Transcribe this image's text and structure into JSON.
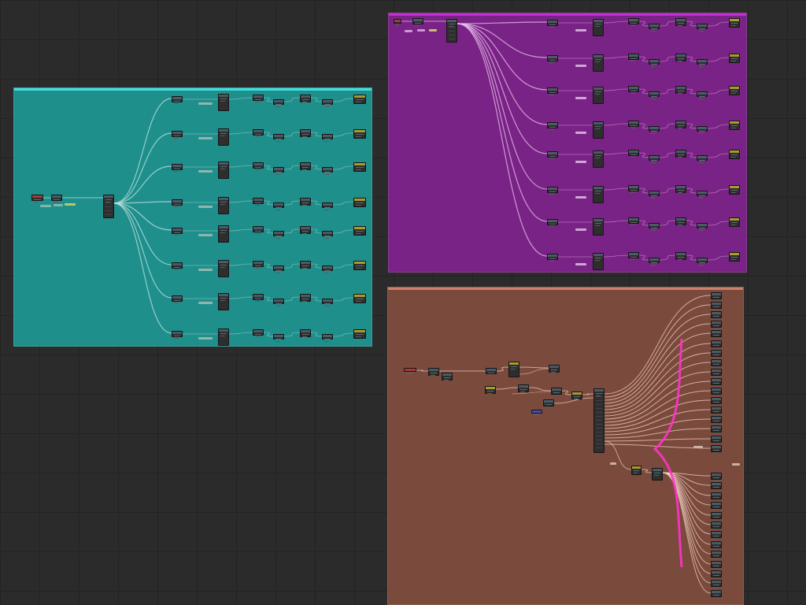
{
  "canvas": {
    "background": "#2b2b2b",
    "grid_color": "#232323"
  },
  "groups": [
    {
      "id": "teal",
      "color": "#1f8f8c",
      "title_color": "#3fe0e0",
      "wire_color": "#bde3df"
    },
    {
      "id": "purple",
      "color": "#7a2386",
      "title_color": "#c030d0",
      "wire_color": "#e8c2ec"
    },
    {
      "id": "brown",
      "color": "#7a4a3c",
      "title_color": "#d0806a",
      "wire_color": "#f0cfc2",
      "accent_wire_color": "#ff33c8"
    }
  ],
  "node_colors": {
    "default": "#2e2e2e",
    "header": "#4a5a66",
    "red": "#a63a3a",
    "yellow": "#a89a2e",
    "purple": "#5148a0"
  }
}
